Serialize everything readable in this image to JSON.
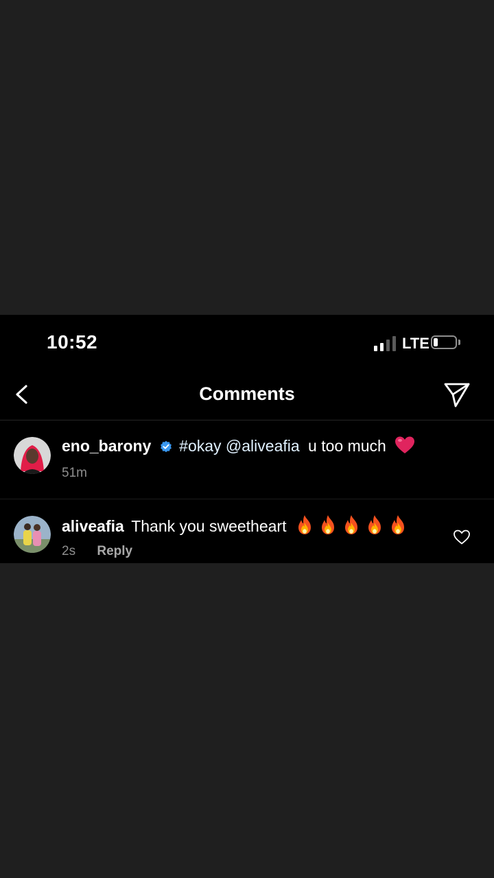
{
  "status_bar": {
    "time": "10:52",
    "network": "LTE",
    "signal_bars": 2,
    "signal_bars_total": 4,
    "battery_level": 0.2
  },
  "header": {
    "title": "Comments",
    "back_icon": "chevron-left-icon",
    "share_icon": "paper-plane-icon"
  },
  "comments": [
    {
      "username": "eno_barony",
      "verified": true,
      "hashtag": "#okay",
      "mention": "@aliveafia",
      "text": "u too much",
      "emoji": "red-heart",
      "time": "51m"
    },
    {
      "username": "aliveafia",
      "text": "Thank you sweetheart",
      "emoji": "fire",
      "emoji_count": 5,
      "time": "2s",
      "reply_label": "Reply",
      "like_icon": "heart-outline-icon"
    }
  ],
  "colors": {
    "background_outer": "#1f1f1f",
    "screen": "#000000",
    "verified_badge": "#3897f0",
    "muted_text": "#8e8e8e",
    "tag_text": "#e0f1ff",
    "heart": "#e0245e"
  }
}
